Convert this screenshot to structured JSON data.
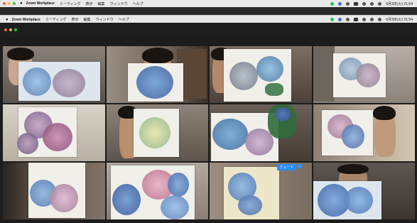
{
  "menubar": {
    "app_name": "Zoom Workplace",
    "items": [
      "ミーティング",
      "表示",
      "編集",
      "ウィンドウ",
      "ヘルプ"
    ],
    "date": "6月3日(火) 21:54"
  },
  "menubar2": {
    "app_name": "Zoom Workplace",
    "items": [
      "ミーティング",
      "表示",
      "編集",
      "ウィンドウ",
      "ヘルプ"
    ],
    "date": "6月3日(火) 21:54"
  },
  "tiles": [
    {
      "kind": "participant-video"
    },
    {
      "kind": "participant-video",
      "active_speaker": true
    },
    {
      "kind": "participant-video"
    },
    {
      "kind": "participant-video"
    },
    {
      "kind": "participant-video"
    },
    {
      "kind": "participant-video"
    },
    {
      "kind": "participant-video"
    },
    {
      "kind": "participant-video"
    },
    {
      "kind": "participant-video"
    },
    {
      "kind": "participant-video"
    },
    {
      "kind": "participant-video",
      "overlay_label": "ミュート",
      "overlay_more": "…"
    },
    {
      "kind": "participant-video"
    }
  ],
  "colors": {
    "active_speaker_border": "#5ec24a",
    "zoom_blue": "#2d8cff"
  }
}
